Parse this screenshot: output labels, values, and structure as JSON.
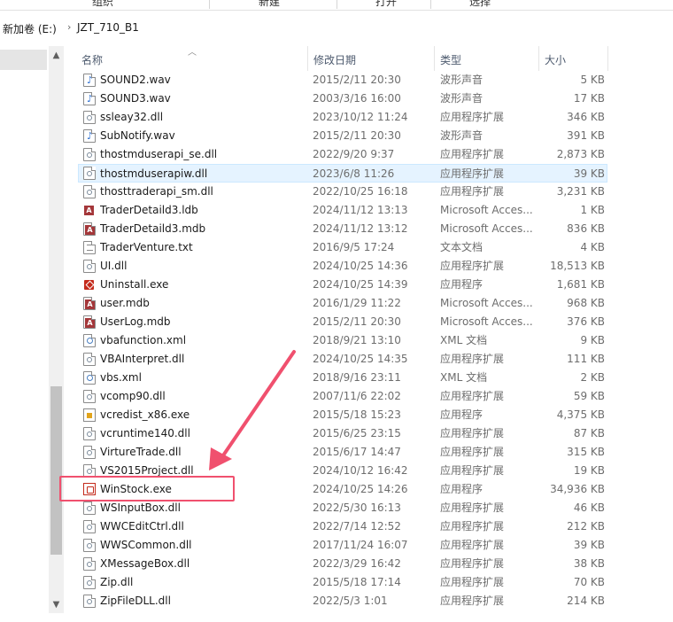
{
  "ribbon": {
    "groups": [
      "组织",
      "新建",
      "打开",
      "选择"
    ]
  },
  "breadcrumb": {
    "drive": "新加卷 (E:)",
    "folder": "JZT_710_B1",
    "separator": "›"
  },
  "columns": {
    "name": "名称",
    "date": "修改日期",
    "type": "类型",
    "size": "大小"
  },
  "files": [
    {
      "name": "SOUND2.wav",
      "date": "2015/2/11 20:30",
      "type": "波形声音",
      "size": "5 KB",
      "icon": "audio-icon"
    },
    {
      "name": "SOUND3.wav",
      "date": "2003/3/16 16:00",
      "type": "波形声音",
      "size": "17 KB",
      "icon": "audio-icon"
    },
    {
      "name": "ssleay32.dll",
      "date": "2023/10/12 11:24",
      "type": "应用程序扩展",
      "size": "346 KB",
      "icon": "dll-icon"
    },
    {
      "name": "SubNotify.wav",
      "date": "2015/2/11 20:30",
      "type": "波形声音",
      "size": "391 KB",
      "icon": "audio-icon"
    },
    {
      "name": "thostmduserapi_se.dll",
      "date": "2022/9/20 9:37",
      "type": "应用程序扩展",
      "size": "2,873 KB",
      "icon": "dll-icon"
    },
    {
      "name": "thostmduserapiw.dll",
      "date": "2023/6/8 11:26",
      "type": "应用程序扩展",
      "size": "39 KB",
      "icon": "dll-icon",
      "selected": true
    },
    {
      "name": "thosttraderapi_sm.dll",
      "date": "2022/10/25 16:18",
      "type": "应用程序扩展",
      "size": "3,231 KB",
      "icon": "dll-icon"
    },
    {
      "name": "TraderDetaild3.ldb",
      "date": "2024/11/12 13:13",
      "type": "Microsoft Acces...",
      "size": "1 KB",
      "icon": "access-lock-icon"
    },
    {
      "name": "TraderDetaild3.mdb",
      "date": "2024/11/12 13:12",
      "type": "Microsoft Acces...",
      "size": "836 KB",
      "icon": "access-icon"
    },
    {
      "name": "TraderVenture.txt",
      "date": "2016/9/5 17:24",
      "type": "文本文档",
      "size": "4 KB",
      "icon": "text-icon"
    },
    {
      "name": "UI.dll",
      "date": "2024/10/25 14:36",
      "type": "应用程序扩展",
      "size": "18,513 KB",
      "icon": "dll-icon"
    },
    {
      "name": "Uninstall.exe",
      "date": "2024/10/25 14:39",
      "type": "应用程序",
      "size": "1,681 KB",
      "icon": "uninstall-icon"
    },
    {
      "name": "user.mdb",
      "date": "2016/1/29 11:22",
      "type": "Microsoft Acces...",
      "size": "968 KB",
      "icon": "access-icon"
    },
    {
      "name": "UserLog.mdb",
      "date": "2015/2/11 20:30",
      "type": "Microsoft Acces...",
      "size": "376 KB",
      "icon": "access-icon"
    },
    {
      "name": "vbafunction.xml",
      "date": "2018/9/21 13:10",
      "type": "XML 文档",
      "size": "9 KB",
      "icon": "xml-icon"
    },
    {
      "name": "VBAInterpret.dll",
      "date": "2024/10/25 14:35",
      "type": "应用程序扩展",
      "size": "111 KB",
      "icon": "dll-icon"
    },
    {
      "name": "vbs.xml",
      "date": "2018/9/16 23:11",
      "type": "XML 文档",
      "size": "2 KB",
      "icon": "xml-icon"
    },
    {
      "name": "vcomp90.dll",
      "date": "2007/11/6 22:02",
      "type": "应用程序扩展",
      "size": "59 KB",
      "icon": "dll-icon"
    },
    {
      "name": "vcredist_x86.exe",
      "date": "2015/5/18 15:23",
      "type": "应用程序",
      "size": "4,375 KB",
      "icon": "installer-icon"
    },
    {
      "name": "vcruntime140.dll",
      "date": "2015/6/25 23:15",
      "type": "应用程序扩展",
      "size": "87 KB",
      "icon": "dll-icon"
    },
    {
      "name": "VirtureTrade.dll",
      "date": "2015/6/17 14:47",
      "type": "应用程序扩展",
      "size": "315 KB",
      "icon": "dll-icon"
    },
    {
      "name": "VS2015Project.dll",
      "date": "2024/10/12 16:42",
      "type": "应用程序扩展",
      "size": "19 KB",
      "icon": "dll-icon"
    },
    {
      "name": "WinStock.exe",
      "date": "2024/10/25 14:26",
      "type": "应用程序",
      "size": "34,936 KB",
      "icon": "winstock-app-icon",
      "highlighted": true
    },
    {
      "name": "WSInputBox.dll",
      "date": "2022/5/30 16:13",
      "type": "应用程序扩展",
      "size": "46 KB",
      "icon": "dll-icon"
    },
    {
      "name": "WWCEditCtrl.dll",
      "date": "2022/7/14 12:52",
      "type": "应用程序扩展",
      "size": "212 KB",
      "icon": "dll-icon"
    },
    {
      "name": "WWSCommon.dll",
      "date": "2017/11/24 16:07",
      "type": "应用程序扩展",
      "size": "39 KB",
      "icon": "dll-icon"
    },
    {
      "name": "XMessageBox.dll",
      "date": "2022/3/29 16:42",
      "type": "应用程序扩展",
      "size": "38 KB",
      "icon": "dll-icon"
    },
    {
      "name": "Zip.dll",
      "date": "2015/5/18 17:14",
      "type": "应用程序扩展",
      "size": "70 KB",
      "icon": "dll-icon"
    },
    {
      "name": "ZipFileDLL.dll",
      "date": "2022/5/3 1:01",
      "type": "应用程序扩展",
      "size": "214 KB",
      "icon": "dll-icon"
    }
  ],
  "annotation": {
    "color": "#f0506e"
  }
}
